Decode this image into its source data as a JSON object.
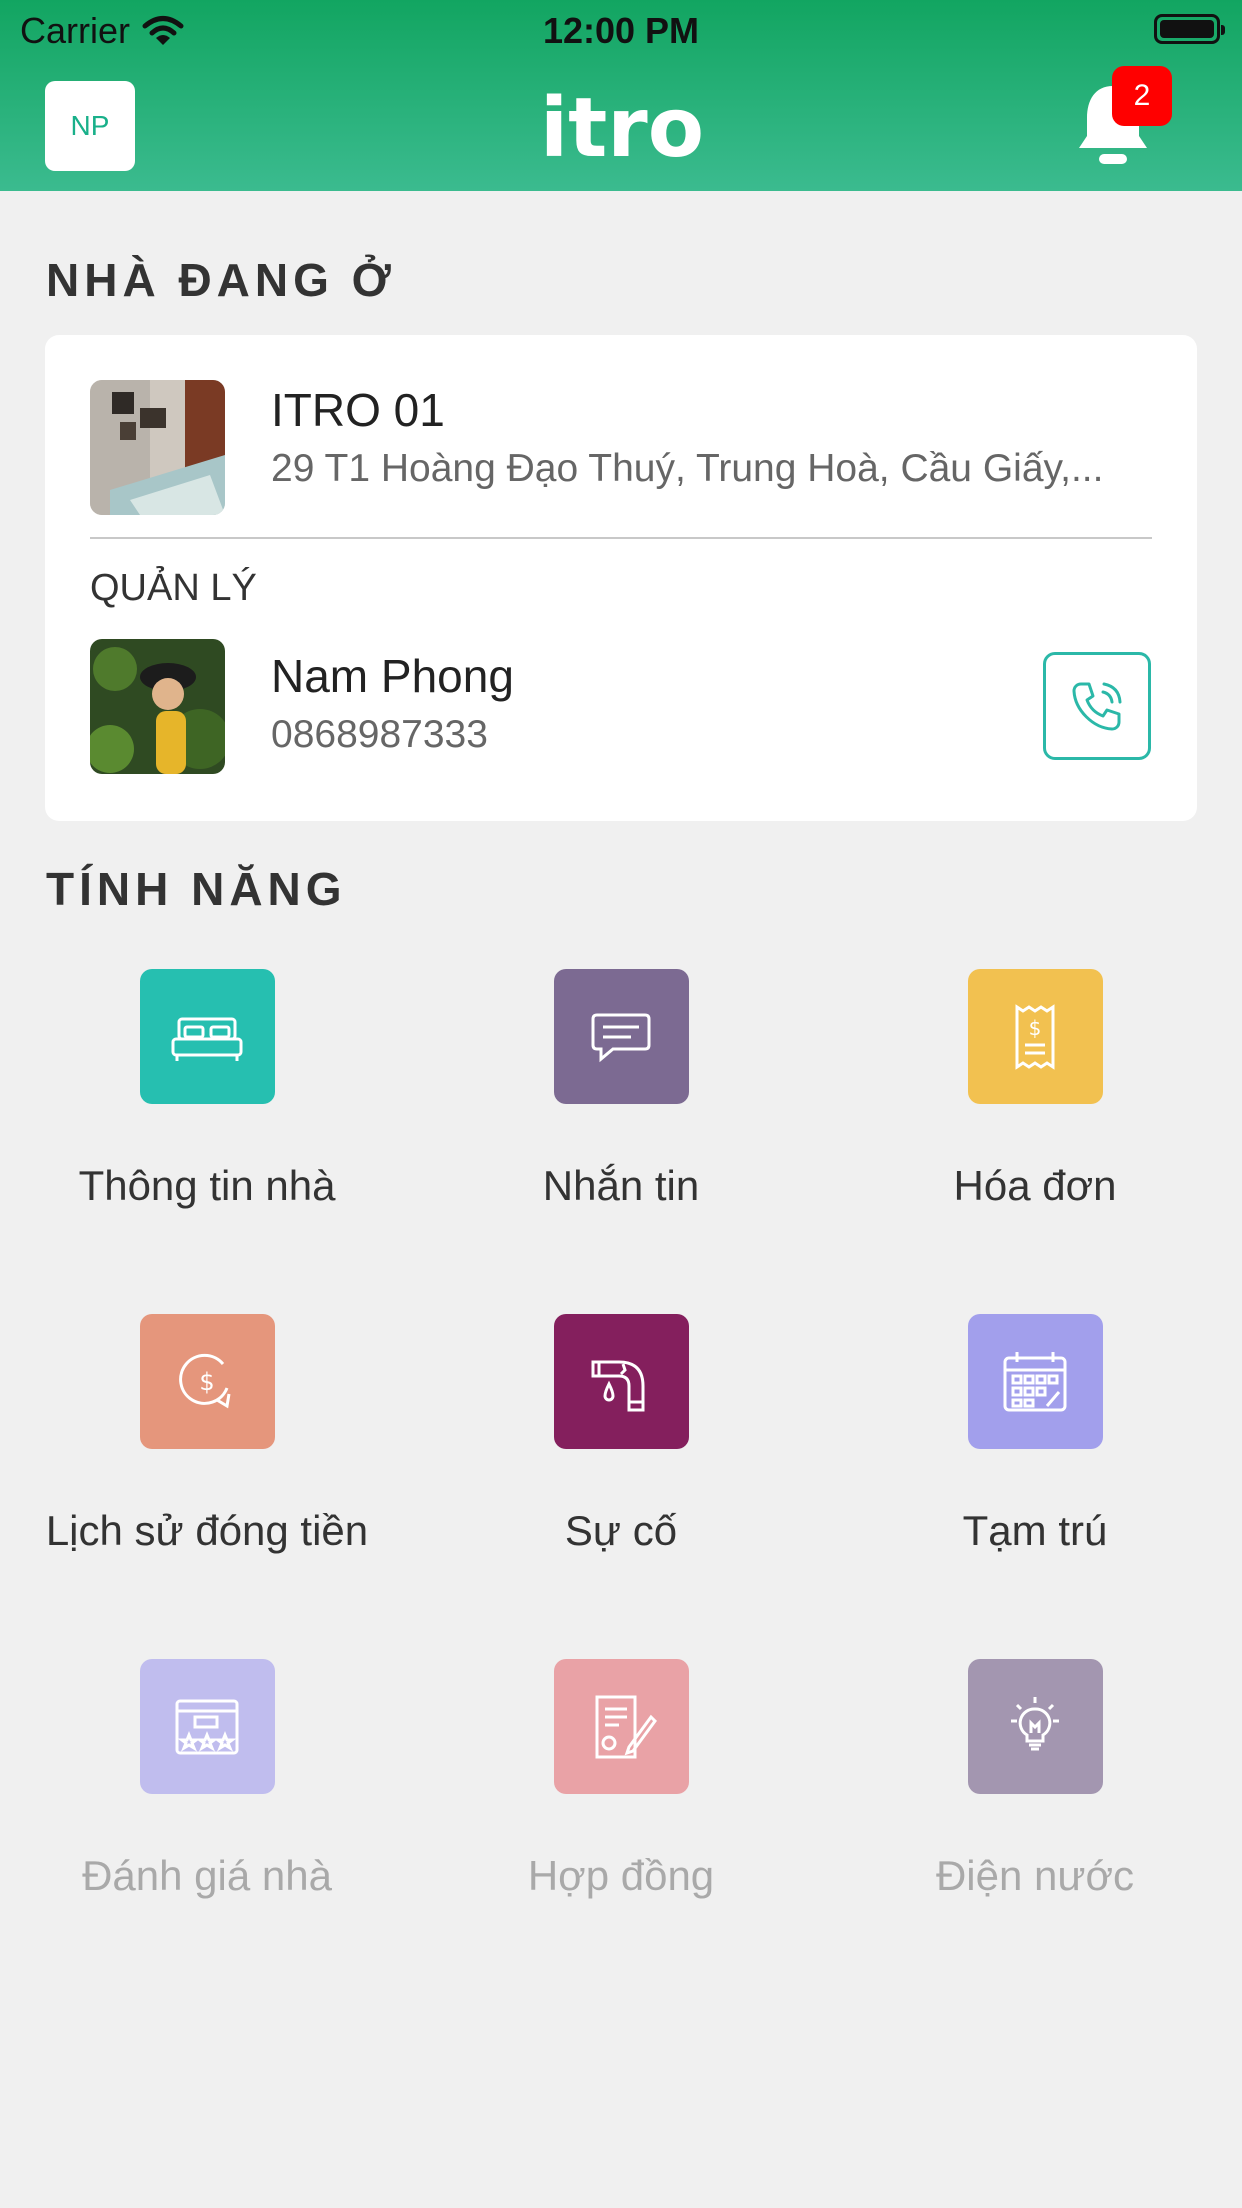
{
  "status_bar": {
    "carrier": "Carrier",
    "time": "12:00 PM"
  },
  "header": {
    "avatar_initials": "NP",
    "logo": "itro",
    "notification_count": "2"
  },
  "house_section": {
    "title": "NHÀ ĐANG Ở",
    "house": {
      "name": "ITRO 01",
      "address": "29 T1 Hoàng Đạo Thuý, Trung Hoà, Cầu Giấy,..."
    },
    "manager_label": "QUẢN LÝ",
    "manager": {
      "name": "Nam Phong",
      "phone": "0868987333"
    }
  },
  "features_section": {
    "title": "TÍNH NĂNG",
    "items": [
      {
        "label": "Thông tin nhà",
        "icon": "bed-icon",
        "color": "#26bfb0",
        "enabled": true
      },
      {
        "label": "Nhắn tin",
        "icon": "chat-icon",
        "color": "#7c6a92",
        "enabled": true
      },
      {
        "label": "Hóa đơn",
        "icon": "receipt-icon",
        "color": "#f2c150",
        "enabled": true
      },
      {
        "label": "Lịch sử đóng tiền",
        "icon": "payment-history-icon",
        "color": "#e5967c",
        "enabled": true
      },
      {
        "label": "Sự cố",
        "icon": "leaking-pipe-icon",
        "color": "#841f5d",
        "enabled": true
      },
      {
        "label": "Tạm trú",
        "icon": "calendar-icon",
        "color": "#a29fec",
        "enabled": true
      },
      {
        "label": "Đánh giá nhà",
        "icon": "rating-icon",
        "color": "#c0bdee",
        "enabled": false
      },
      {
        "label": "Hợp đồng",
        "icon": "contract-icon",
        "color": "#e9a2a6",
        "enabled": false
      },
      {
        "label": "Điện nước",
        "icon": "light-bulb-icon",
        "color": "#a396b0",
        "enabled": false
      }
    ]
  }
}
